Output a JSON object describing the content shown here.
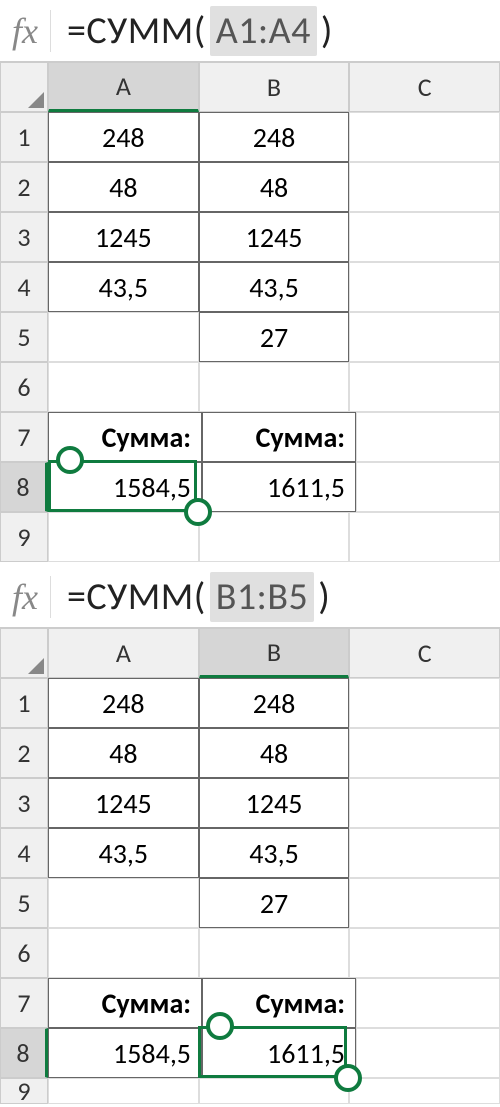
{
  "top": {
    "formula": {
      "fx": "fx",
      "prefix": "=СУММ(",
      "range": "A1:A4",
      "suffix": ")"
    },
    "columns": [
      "A",
      "B",
      "C"
    ],
    "selectedCol": "A",
    "rows": [
      "1",
      "2",
      "3",
      "4",
      "5",
      "6",
      "7",
      "8",
      "9"
    ],
    "selectedRow": "8",
    "cells": {
      "A1": "248",
      "B1": "248",
      "A2": "48",
      "B2": "48",
      "A3": "1245",
      "B3": "1245",
      "A4": "43,5",
      "B4": "43,5",
      "B5": "27",
      "A7": "Сумма:",
      "B7": "Сумма:",
      "A8": "1584,5",
      "B8": "1611,5"
    }
  },
  "bottom": {
    "formula": {
      "fx": "fx",
      "prefix": "=СУММ(",
      "range": "B1:B5",
      "suffix": ")"
    },
    "columns": [
      "A",
      "B",
      "C"
    ],
    "selectedCol": "B",
    "rows": [
      "1",
      "2",
      "3",
      "4",
      "5",
      "6",
      "7",
      "8",
      "9"
    ],
    "selectedRow": "8",
    "cells": {
      "A1": "248",
      "B1": "248",
      "A2": "48",
      "B2": "48",
      "A3": "1245",
      "B3": "1245",
      "A4": "43,5",
      "B4": "43,5",
      "B5": "27",
      "A7": "Сумма:",
      "B7": "Сумма:",
      "A8": "1584,5",
      "B8": "1611,5"
    }
  }
}
